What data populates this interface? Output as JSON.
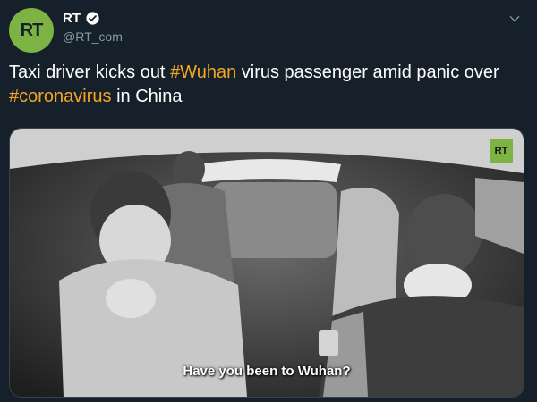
{
  "account": {
    "display_name": "RT",
    "handle": "@RT_com",
    "avatar_text": "RT",
    "brand_color": "#7cb342",
    "verified": true
  },
  "tweet": {
    "segments": [
      {
        "text": "Taxi driver kicks out ",
        "hashtag": false
      },
      {
        "text": "#Wuhan",
        "hashtag": true
      },
      {
        "text": " virus passenger amid panic over ",
        "hashtag": false
      },
      {
        "text": "#coronavirus",
        "hashtag": true
      },
      {
        "text": " in China",
        "hashtag": false
      }
    ]
  },
  "media": {
    "watermark": "RT",
    "caption": "Have you been to Wuhan?"
  },
  "colors": {
    "background": "#15202b",
    "hashtag": "#f5a623",
    "handle": "#8899a6"
  },
  "icons": {
    "verified": "verified-badge-icon",
    "menu": "chevron-down-icon"
  }
}
